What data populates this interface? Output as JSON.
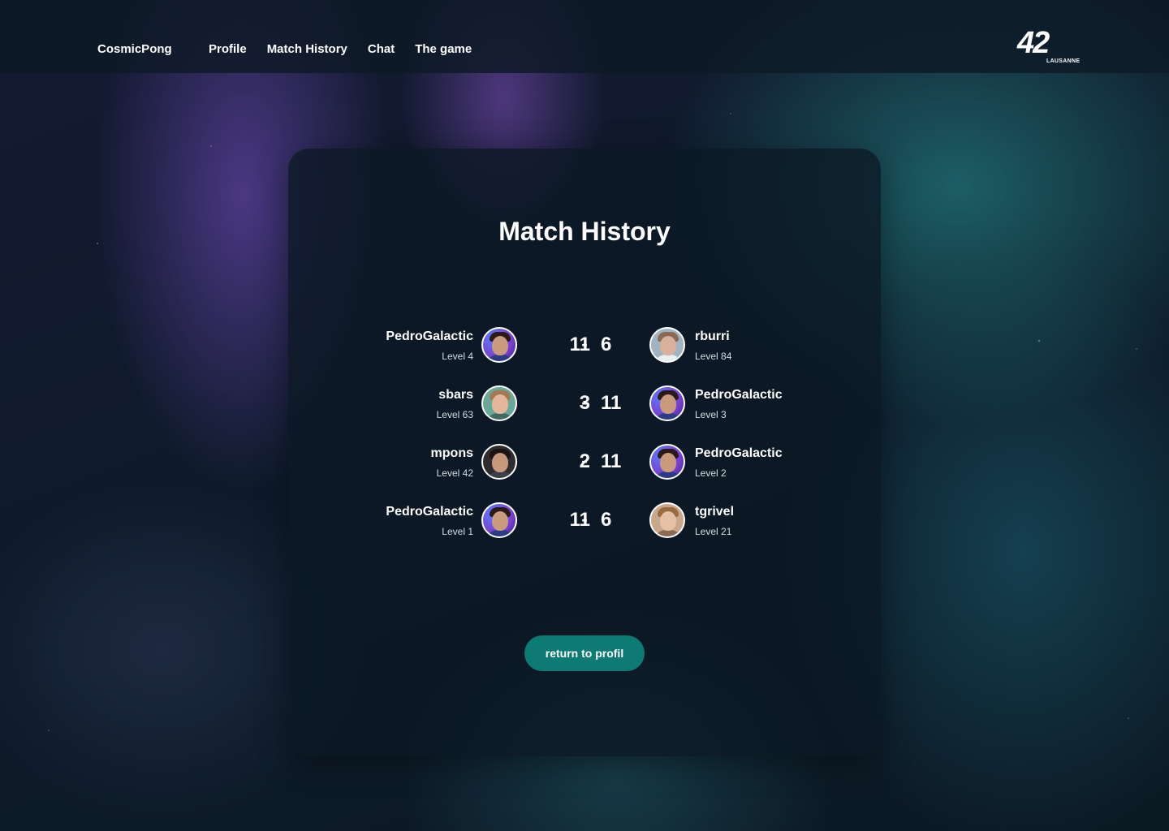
{
  "nav": {
    "brand": "CosmicPong",
    "links": [
      "Profile",
      "Match History",
      "Chat",
      "The game"
    ],
    "logo_number": "42",
    "logo_subtitle": "LAUSANNE"
  },
  "main": {
    "title": "Match History",
    "matches": [
      {
        "left": {
          "name": "PedroGalactic",
          "level": "Level 4",
          "avatar": "avatar-galactic"
        },
        "score_left": "11",
        "separator": "-",
        "score_right": "6",
        "right": {
          "name": "rburri",
          "level": "Level 84",
          "avatar": "avatar-light"
        }
      },
      {
        "left": {
          "name": "sbars",
          "level": "Level 63",
          "avatar": "avatar-green"
        },
        "score_left": "3",
        "separator": "-",
        "score_right": "11",
        "right": {
          "name": "PedroGalactic",
          "level": "Level 3",
          "avatar": "avatar-galactic"
        }
      },
      {
        "left": {
          "name": "mpons",
          "level": "Level 42",
          "avatar": "avatar-dark"
        },
        "score_left": "2",
        "separator": "-",
        "score_right": "11",
        "right": {
          "name": "PedroGalactic",
          "level": "Level 2",
          "avatar": "avatar-galactic"
        }
      },
      {
        "left": {
          "name": "PedroGalactic",
          "level": "Level 1",
          "avatar": "avatar-galactic"
        },
        "score_left": "11",
        "separator": "-",
        "score_right": "6",
        "right": {
          "name": "tgrivel",
          "level": "Level 21",
          "avatar": "avatar-warm"
        }
      }
    ],
    "return_button": "return to profil"
  },
  "colors": {
    "accent": "#0d7a73",
    "card": "#0c1824",
    "text": "#ffffff"
  }
}
